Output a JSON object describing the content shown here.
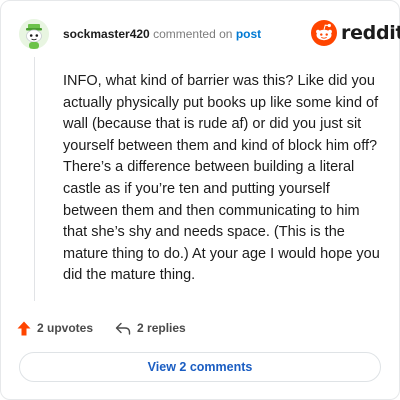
{
  "header": {
    "username": "sockmaster420",
    "meta_text": "commented on",
    "post_link": "post"
  },
  "brand": {
    "wordmark": "reddit",
    "logo_icon": "reddit-snoo-icon",
    "logo_color": "#ff4500"
  },
  "avatar": {
    "icon": "snoo-avatar-icon",
    "accent_color": "#6cc24a"
  },
  "comment": {
    "body": "INFO, what kind of barrier was this? Like did you actually physically put books up like some kind of wall (because that is rude af) or did you just sit yourself between them and kind of block him off? There’s a difference between building a literal castle as if you’re ten and putting yourself between them and then communicating to him that she’s shy and needs space. (This is the mature thing to do.) At your age I would hope you did the mature thing."
  },
  "actions": {
    "upvotes": "2 upvotes",
    "upvote_icon": "upvote-arrow-icon",
    "upvote_color": "#ff4500",
    "replies": "2 replies",
    "reply_icon": "reply-arrow-icon"
  },
  "footer": {
    "view_comments": "View 2 comments",
    "link_color": "#1a5dc2"
  }
}
